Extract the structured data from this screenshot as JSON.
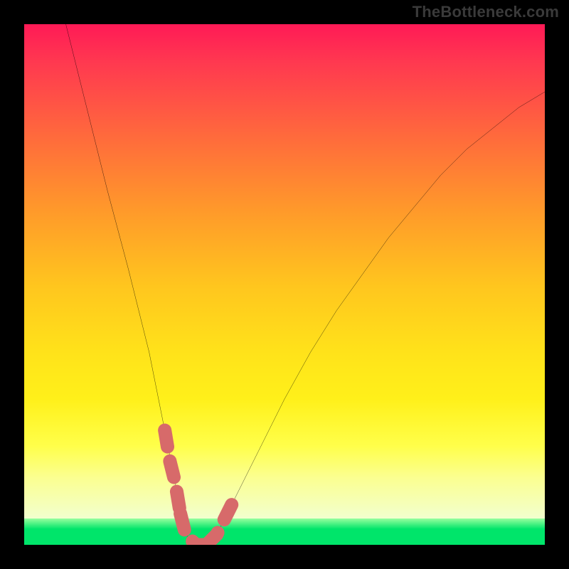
{
  "watermark": "TheBottleneck.com",
  "chart_data": {
    "type": "line",
    "title": "",
    "xlabel": "",
    "ylabel": "",
    "xlim": [
      0,
      100
    ],
    "ylim": [
      0,
      100
    ],
    "series": [
      {
        "name": "bottleneck-curve",
        "x": [
          8,
          12,
          16,
          20,
          24,
          27,
          29,
          30,
          31,
          33,
          35,
          37,
          40,
          45,
          50,
          55,
          60,
          65,
          70,
          75,
          80,
          85,
          90,
          95,
          100
        ],
        "values": [
          100,
          84,
          68,
          53,
          37,
          22,
          12,
          6,
          2,
          0,
          0,
          2,
          8,
          18,
          28,
          37,
          45,
          52,
          59,
          65,
          71,
          76,
          80,
          84,
          87
        ]
      },
      {
        "name": "highlight-segment-left",
        "x": [
          27,
          28,
          29,
          30
        ],
        "values": [
          22,
          16,
          12,
          6
        ]
      },
      {
        "name": "highlight-segment-bottom",
        "x": [
          30,
          31,
          33,
          35
        ],
        "values": [
          6,
          2,
          0,
          0
        ]
      },
      {
        "name": "highlight-segment-right",
        "x": [
          35,
          37,
          39,
          40
        ],
        "values": [
          0,
          2,
          6,
          8
        ]
      }
    ],
    "background_zones": [
      {
        "name": "red-to-yellow-gradient",
        "y_from": 28,
        "y_to": 100
      },
      {
        "name": "yellow",
        "y_from": 13,
        "y_to": 28
      },
      {
        "name": "pale-yellow",
        "y_from": 5,
        "y_to": 13
      },
      {
        "name": "green",
        "y_from": 0,
        "y_to": 5
      }
    ],
    "colors": {
      "curve": "#000000",
      "highlight": "#d76a6a",
      "frame": "#000000"
    }
  }
}
